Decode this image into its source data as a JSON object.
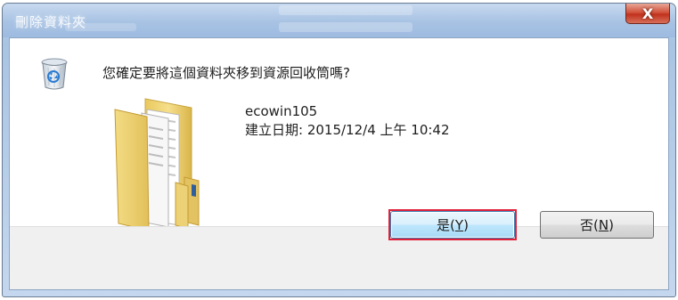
{
  "window": {
    "title": "刪除資料夾",
    "close_label": "X"
  },
  "dialog": {
    "question": "您確定要將這個資料夾移到資源回收筒嗎?",
    "folder_name": "ecowin105",
    "created_label": "建立日期: 2015/12/4 上午 10:42",
    "icons": [
      "recycle-bin-icon",
      "folder-icon"
    ]
  },
  "buttons": {
    "yes_text": "是(",
    "yes_key": "Y",
    "yes_close": ")",
    "no_text": "否(",
    "no_key": "N",
    "no_close": ")"
  },
  "colors": {
    "highlight": "#e2203a",
    "titlebar": "#a9c4e3",
    "close": "#c0321d"
  }
}
